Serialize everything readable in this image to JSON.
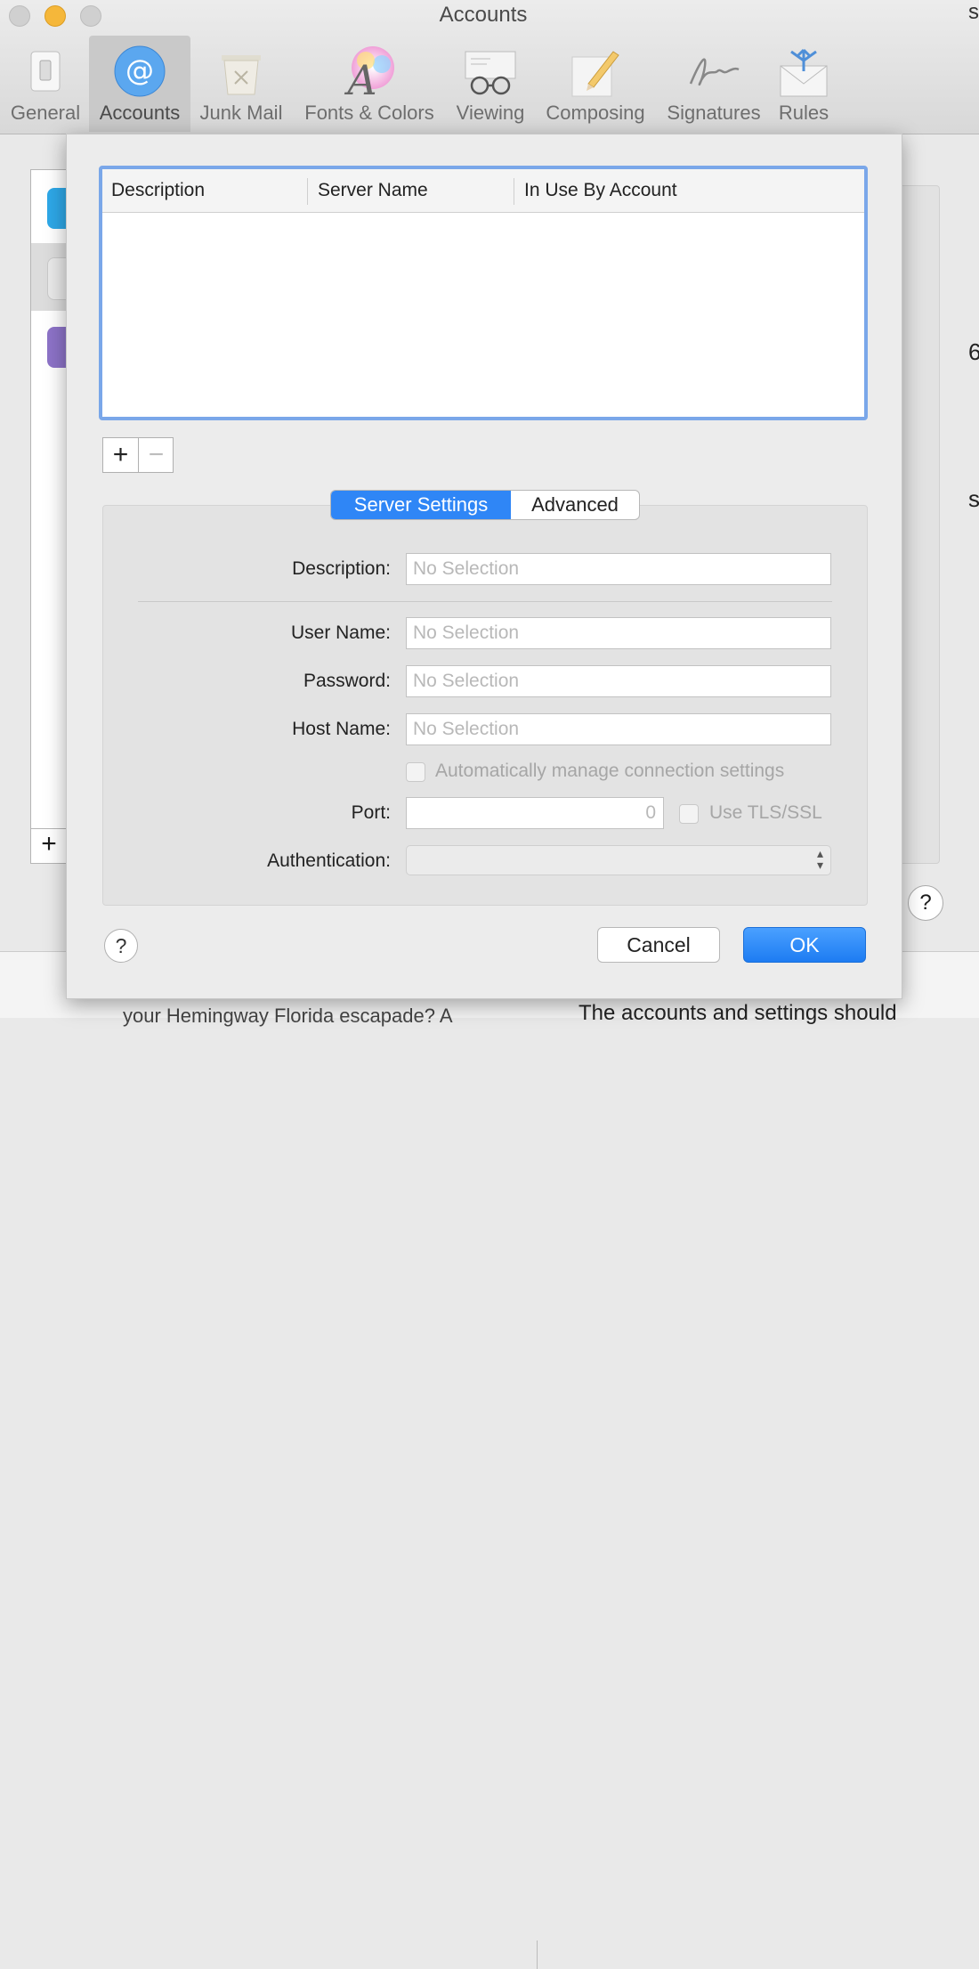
{
  "window": {
    "title": "Accounts"
  },
  "toolbar": {
    "items": [
      {
        "label": "General",
        "icon": "general-switch-icon"
      },
      {
        "label": "Accounts",
        "icon": "at-sign-icon",
        "active": true
      },
      {
        "label": "Junk Mail",
        "icon": "junk-mail-trash-icon"
      },
      {
        "label": "Fonts & Colors",
        "icon": "fonts-colors-icon"
      },
      {
        "label": "Viewing",
        "icon": "viewing-glasses-icon"
      },
      {
        "label": "Composing",
        "icon": "composing-pencil-icon"
      },
      {
        "label": "Signatures",
        "icon": "signature-icon"
      },
      {
        "label": "Rules",
        "icon": "rules-envelope-icon"
      }
    ]
  },
  "smtp_table": {
    "columns": [
      "Description",
      "Server Name",
      "In Use By Account"
    ],
    "rows": []
  },
  "list_controls": {
    "add": "+",
    "remove": "−"
  },
  "tabs": {
    "server_settings": "Server Settings",
    "advanced": "Advanced"
  },
  "form": {
    "description_label": "Description:",
    "description_placeholder": "No Selection",
    "username_label": "User Name:",
    "username_placeholder": "No Selection",
    "password_label": "Password:",
    "password_placeholder": "No Selection",
    "hostname_label": "Host Name:",
    "hostname_placeholder": "No Selection",
    "auto_manage_label": "Automatically manage connection settings",
    "port_label": "Port:",
    "port_value": "0",
    "tls_label": "Use TLS/SSL",
    "auth_label": "Authentication:",
    "auth_value": ""
  },
  "buttons": {
    "help": "?",
    "cancel": "Cancel",
    "ok": "OK"
  },
  "background": {
    "help": "?",
    "plus": "+",
    "text_left": "your Hemingway Florida escapade? A",
    "text_right": "The accounts and settings should"
  },
  "colors": {
    "accent": "#2f86f6",
    "table_focus_ring": "#7aa7e9",
    "ok_button": "#1d7cf2"
  }
}
